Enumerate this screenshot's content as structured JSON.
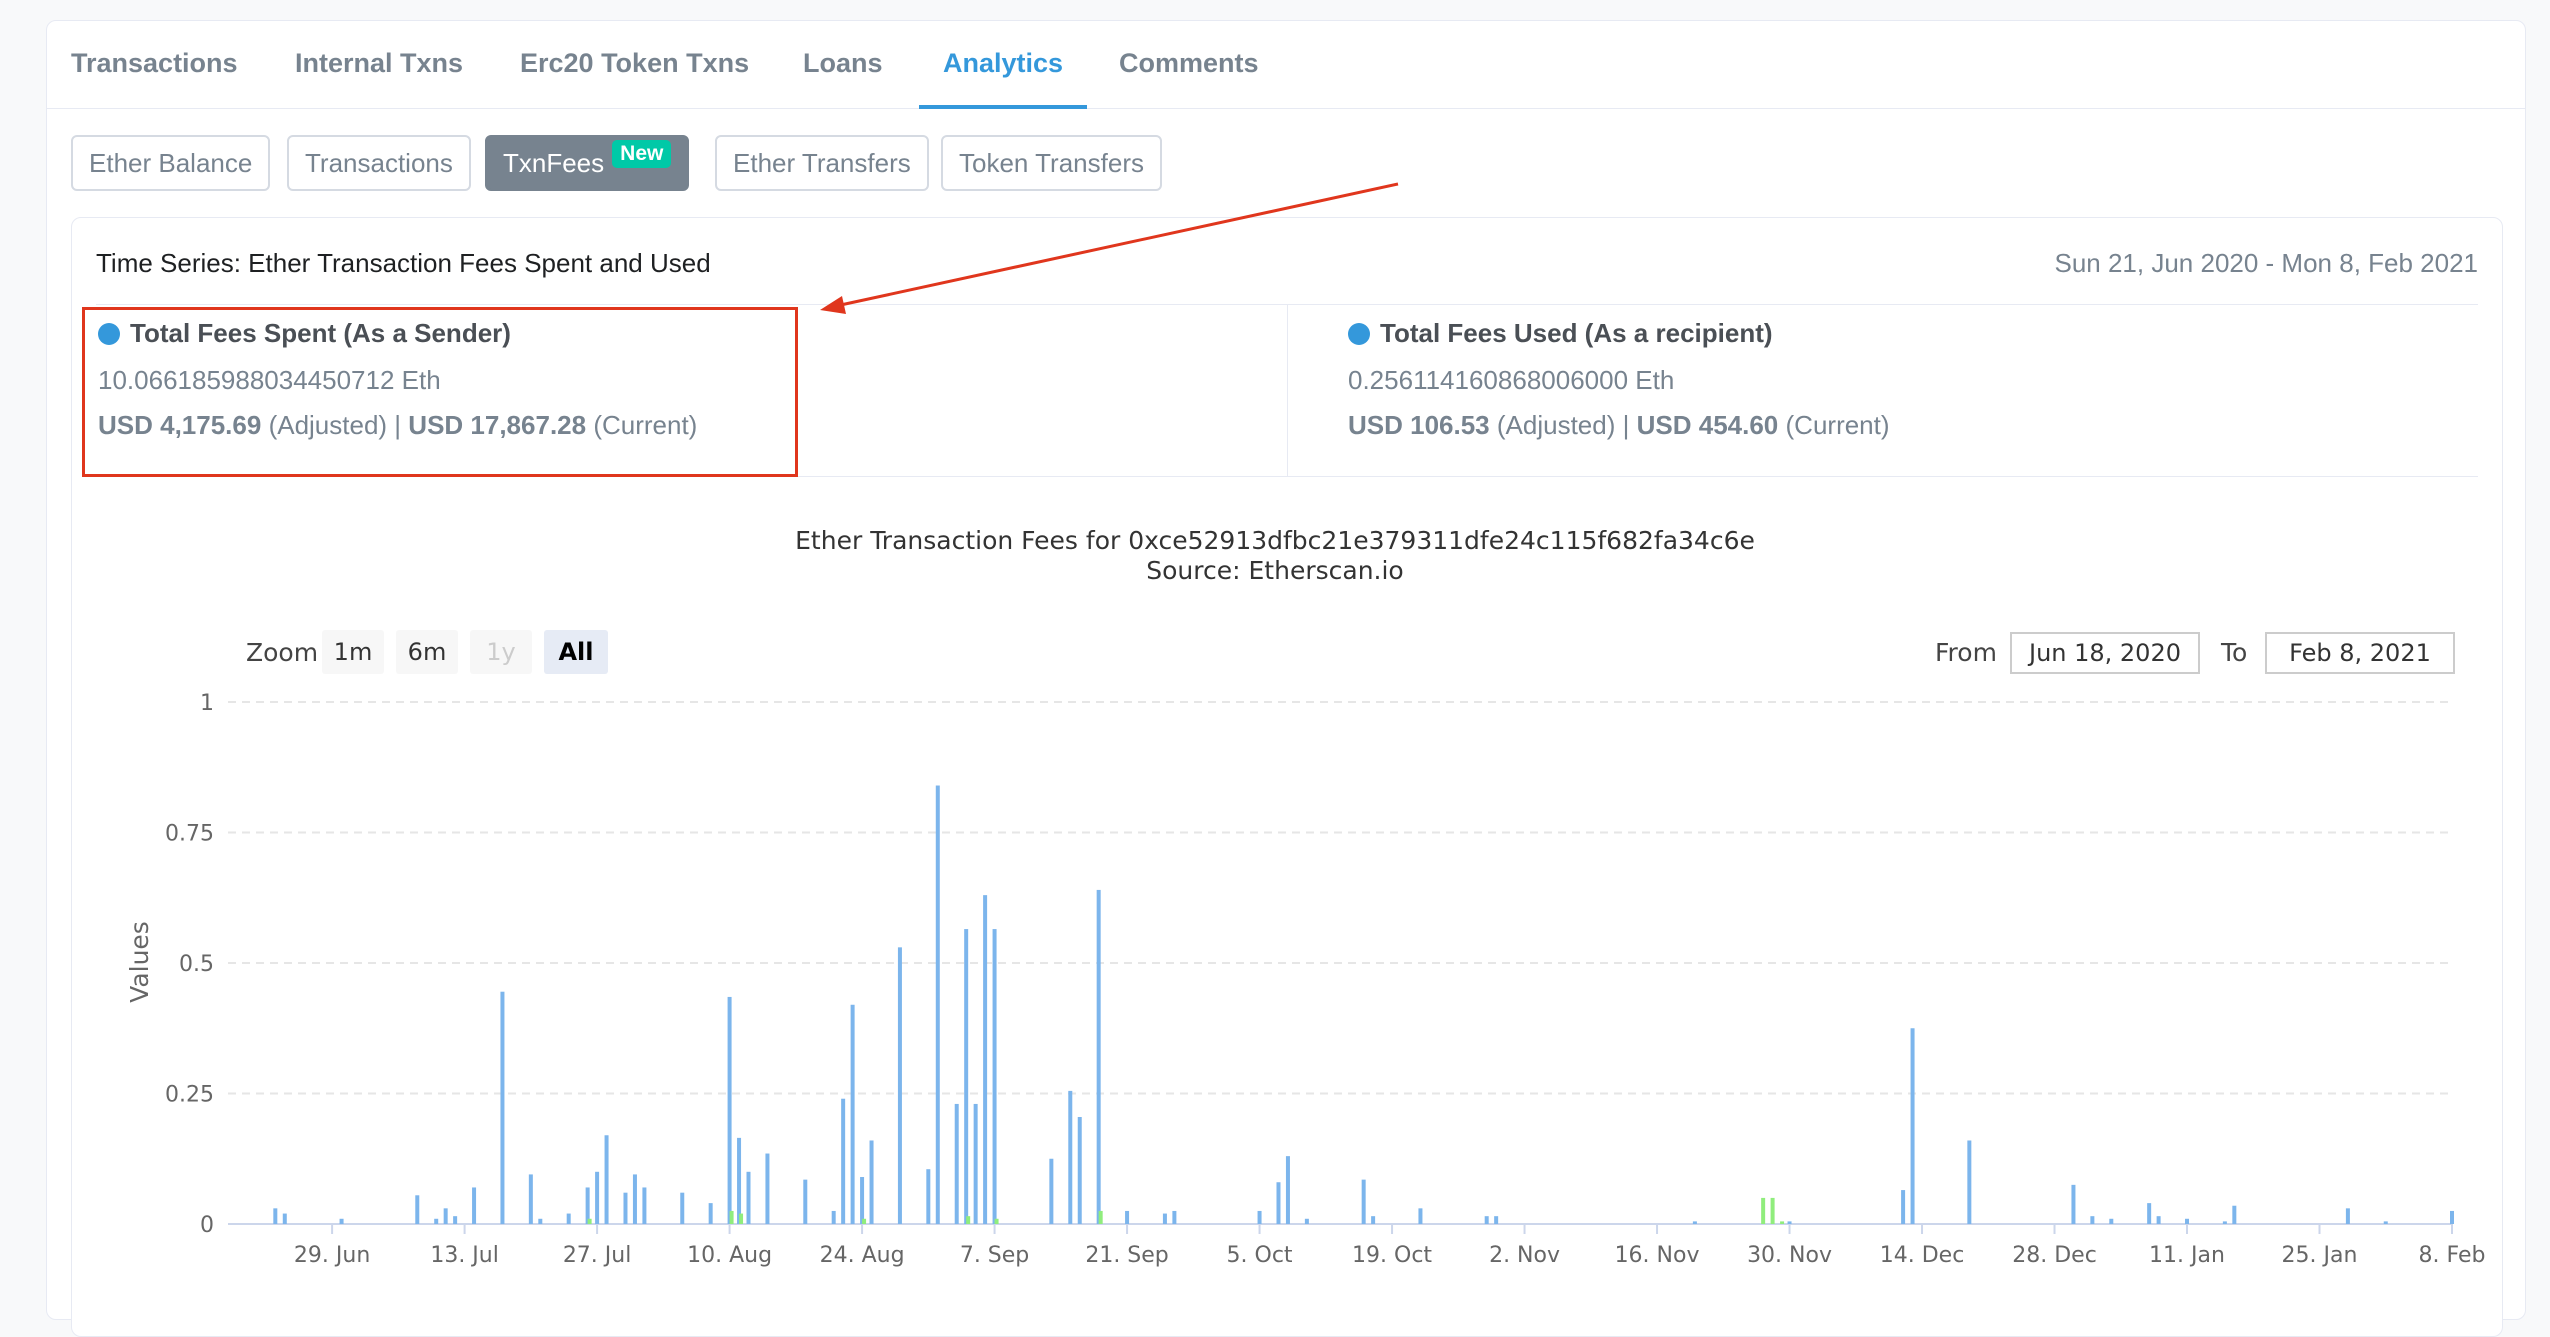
{
  "tabs": [
    {
      "label": "Transactions"
    },
    {
      "label": "Internal Txns"
    },
    {
      "label": "Erc20 Token Txns"
    },
    {
      "label": "Loans"
    },
    {
      "label": "Analytics"
    },
    {
      "label": "Comments"
    }
  ],
  "subtabs": [
    {
      "label": "Ether Balance"
    },
    {
      "label": "Transactions"
    },
    {
      "label": "TxnFees",
      "badge": "New"
    },
    {
      "label": "Ether Transfers"
    },
    {
      "label": "Token Transfers"
    }
  ],
  "panel": {
    "title": "Time Series: Ether Transaction Fees Spent and Used",
    "date_range": "Sun 21, Jun 2020 - Mon 8, Feb 2021"
  },
  "stats": {
    "spent": {
      "heading": "Total Fees Spent (As a Sender)",
      "eth": "10.066185988034450712 Eth",
      "usd_adjusted": "USD 4,175.69",
      "adjusted_label": "(Adjusted)",
      "separator": "|",
      "usd_current": "USD 17,867.28",
      "current_label": "(Current)"
    },
    "used": {
      "heading": "Total Fees Used (As a recipient)",
      "eth": "0.256114160868006000 Eth",
      "usd_adjusted": "USD 106.53",
      "adjusted_label": "(Adjusted)",
      "separator": "|",
      "usd_current": "USD 454.60",
      "current_label": "(Current)"
    }
  },
  "zoom": {
    "label": "Zoom",
    "buttons": [
      "1m",
      "6m",
      "1y",
      "All"
    ]
  },
  "range": {
    "from_label": "From",
    "from_value": "Jun 18, 2020",
    "to_label": "To",
    "to_value": "Feb 8, 2021"
  },
  "colors": {
    "accent": "#3498db",
    "spent_bar": "#7cb5ec",
    "used_bar": "#90ed7d",
    "annotation": "#e0361d"
  },
  "chart_data": {
    "type": "bar",
    "title": "Ether Transaction Fees for 0xce52913dfbc21e379311dfe24c115f682fa34c6e",
    "subtitle": "Source: Etherscan.io",
    "ylabel": "Values",
    "ylim": [
      0,
      1
    ],
    "yticks": [
      "0",
      "0.25",
      "0.5",
      "0.75",
      "1"
    ],
    "x_range": [
      "2020-06-18",
      "2021-02-08"
    ],
    "xticks": [
      {
        "date": "2020-06-29",
        "label": "29. Jun"
      },
      {
        "date": "2020-07-13",
        "label": "13. Jul"
      },
      {
        "date": "2020-07-27",
        "label": "27. Jul"
      },
      {
        "date": "2020-08-10",
        "label": "10. Aug"
      },
      {
        "date": "2020-08-24",
        "label": "24. Aug"
      },
      {
        "date": "2020-09-07",
        "label": "7. Sep"
      },
      {
        "date": "2020-09-21",
        "label": "21. Sep"
      },
      {
        "date": "2020-10-05",
        "label": "5. Oct"
      },
      {
        "date": "2020-10-19",
        "label": "19. Oct"
      },
      {
        "date": "2020-11-02",
        "label": "2. Nov"
      },
      {
        "date": "2020-11-16",
        "label": "16. Nov"
      },
      {
        "date": "2020-11-30",
        "label": "30. Nov"
      },
      {
        "date": "2020-12-14",
        "label": "14. Dec"
      },
      {
        "date": "2020-12-28",
        "label": "28. Dec"
      },
      {
        "date": "2021-01-11",
        "label": "11. Jan"
      },
      {
        "date": "2021-01-25",
        "label": "25. Jan"
      },
      {
        "date": "2021-02-08",
        "label": "8. Feb"
      }
    ],
    "series": [
      {
        "color": "#7cb5ec",
        "points": [
          [
            "2020-06-23",
            0.03
          ],
          [
            "2020-06-24",
            0.02
          ],
          [
            "2020-06-30",
            0.01
          ],
          [
            "2020-07-08",
            0.055
          ],
          [
            "2020-07-10",
            0.01
          ],
          [
            "2020-07-11",
            0.03
          ],
          [
            "2020-07-12",
            0.015
          ],
          [
            "2020-07-14",
            0.07
          ],
          [
            "2020-07-17",
            0.445
          ],
          [
            "2020-07-20",
            0.095
          ],
          [
            "2020-07-21",
            0.01
          ],
          [
            "2020-07-24",
            0.02
          ],
          [
            "2020-07-26",
            0.07
          ],
          [
            "2020-07-27",
            0.1
          ],
          [
            "2020-07-28",
            0.17
          ],
          [
            "2020-07-30",
            0.06
          ],
          [
            "2020-07-31",
            0.095
          ],
          [
            "2020-08-01",
            0.07
          ],
          [
            "2020-08-05",
            0.06
          ],
          [
            "2020-08-08",
            0.04
          ],
          [
            "2020-08-10",
            0.435
          ],
          [
            "2020-08-11",
            0.165
          ],
          [
            "2020-08-12",
            0.1
          ],
          [
            "2020-08-14",
            0.135
          ],
          [
            "2020-08-18",
            0.085
          ],
          [
            "2020-08-21",
            0.025
          ],
          [
            "2020-08-22",
            0.24
          ],
          [
            "2020-08-23",
            0.42
          ],
          [
            "2020-08-24",
            0.09
          ],
          [
            "2020-08-25",
            0.16
          ],
          [
            "2020-08-28",
            0.53
          ],
          [
            "2020-08-31",
            0.105
          ],
          [
            "2020-09-01",
            0.84
          ],
          [
            "2020-09-03",
            0.23
          ],
          [
            "2020-09-04",
            0.565
          ],
          [
            "2020-09-05",
            0.23
          ],
          [
            "2020-09-06",
            0.63
          ],
          [
            "2020-09-07",
            0.565
          ],
          [
            "2020-09-13",
            0.125
          ],
          [
            "2020-09-15",
            0.255
          ],
          [
            "2020-09-16",
            0.205
          ],
          [
            "2020-09-18",
            0.64
          ],
          [
            "2020-09-21",
            0.025
          ],
          [
            "2020-09-25",
            0.02
          ],
          [
            "2020-09-26",
            0.025
          ],
          [
            "2020-10-05",
            0.025
          ],
          [
            "2020-10-07",
            0.08
          ],
          [
            "2020-10-08",
            0.13
          ],
          [
            "2020-10-10",
            0.01
          ],
          [
            "2020-10-16",
            0.085
          ],
          [
            "2020-10-17",
            0.015
          ],
          [
            "2020-10-22",
            0.03
          ],
          [
            "2020-10-29",
            0.015
          ],
          [
            "2020-10-30",
            0.015
          ],
          [
            "2020-11-20",
            0.005
          ],
          [
            "2020-11-30",
            0.005
          ],
          [
            "2020-12-12",
            0.065
          ],
          [
            "2020-12-13",
            0.375
          ],
          [
            "2020-12-19",
            0.16
          ],
          [
            "2020-12-30",
            0.075
          ],
          [
            "2021-01-01",
            0.015
          ],
          [
            "2021-01-03",
            0.01
          ],
          [
            "2021-01-07",
            0.04
          ],
          [
            "2021-01-08",
            0.015
          ],
          [
            "2021-01-11",
            0.01
          ],
          [
            "2021-01-15",
            0.005
          ],
          [
            "2021-01-16",
            0.035
          ],
          [
            "2021-01-28",
            0.03
          ],
          [
            "2021-02-01",
            0.005
          ],
          [
            "2021-02-08",
            0.025
          ]
        ]
      },
      {
        "color": "#90ed7d",
        "points": [
          [
            "2020-07-26",
            0.01
          ],
          [
            "2020-08-10",
            0.025
          ],
          [
            "2020-08-11",
            0.02
          ],
          [
            "2020-08-24",
            0.01
          ],
          [
            "2020-09-04",
            0.015
          ],
          [
            "2020-09-07",
            0.01
          ],
          [
            "2020-09-18",
            0.025
          ],
          [
            "2020-11-27",
            0.05
          ],
          [
            "2020-11-28",
            0.05
          ],
          [
            "2020-11-29",
            0.005
          ]
        ]
      }
    ]
  }
}
